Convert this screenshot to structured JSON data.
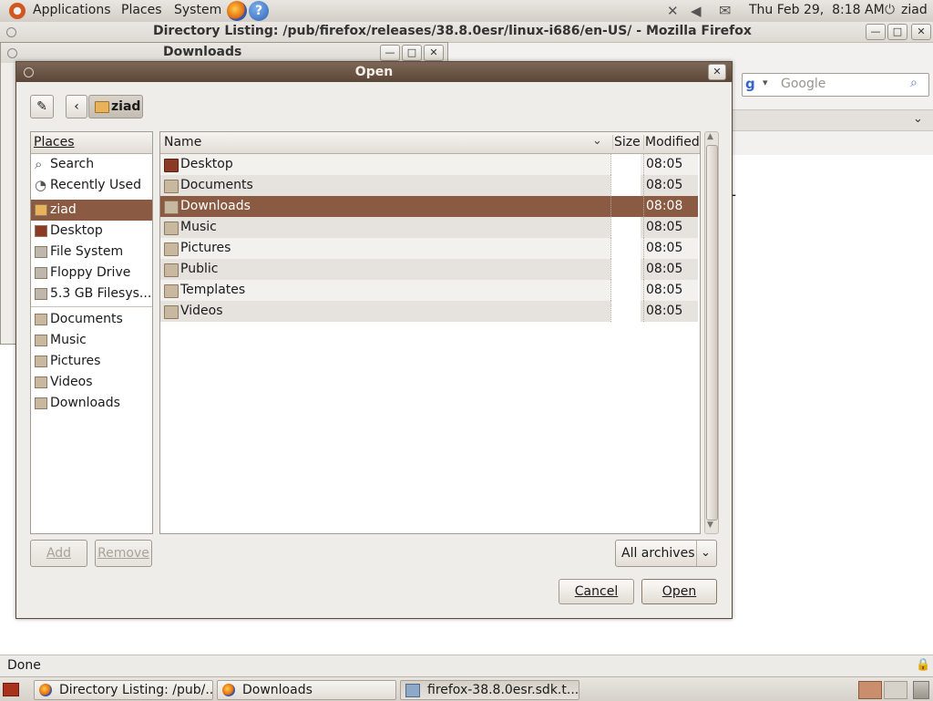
{
  "top_panel": {
    "menus": [
      "Applications",
      "Places",
      "System"
    ],
    "clock": "Thu Feb 29,  8:18 AM",
    "user": "ziad"
  },
  "firefox": {
    "title": "Directory Listing: /pub/firefox/releases/38.8.0esr/linux-i686/en-US/ - Mozilla Firefox",
    "search_placeholder": "Google",
    "status": "Done"
  },
  "downloads_window": {
    "title": "Downloads"
  },
  "dialog": {
    "title": "Open",
    "breadcrumb_current": "ziad",
    "places_header": "Places",
    "places": [
      {
        "label": "Search",
        "icon": "search-icon"
      },
      {
        "label": "Recently Used",
        "icon": "clock-icon"
      },
      {
        "label": "ziad",
        "icon": "home-folder-icon",
        "selected": true
      },
      {
        "label": "Desktop",
        "icon": "desktop-icon"
      },
      {
        "label": "File System",
        "icon": "drive-icon"
      },
      {
        "label": "Floppy Drive",
        "icon": "floppy-icon"
      },
      {
        "label": "5.3 GB Filesys...",
        "icon": "drive-icon"
      }
    ],
    "bookmarks": [
      {
        "label": "Documents",
        "icon": "documents-folder-icon"
      },
      {
        "label": "Music",
        "icon": "music-folder-icon"
      },
      {
        "label": "Pictures",
        "icon": "pictures-folder-icon"
      },
      {
        "label": "Videos",
        "icon": "videos-folder-icon"
      },
      {
        "label": "Downloads",
        "icon": "downloads-folder-icon"
      }
    ],
    "columns": {
      "name": "Name",
      "size": "Size",
      "modified": "Modified"
    },
    "files": [
      {
        "name": "Desktop",
        "size": "",
        "modified": "08:05"
      },
      {
        "name": "Documents",
        "size": "",
        "modified": "08:05"
      },
      {
        "name": "Downloads",
        "size": "",
        "modified": "08:08",
        "selected": true
      },
      {
        "name": "Music",
        "size": "",
        "modified": "08:05"
      },
      {
        "name": "Pictures",
        "size": "",
        "modified": "08:05"
      },
      {
        "name": "Public",
        "size": "",
        "modified": "08:05"
      },
      {
        "name": "Templates",
        "size": "",
        "modified": "08:05"
      },
      {
        "name": "Videos",
        "size": "",
        "modified": "08:05"
      }
    ],
    "add_label": "Add",
    "remove_label": "Remove",
    "filter": "All archives",
    "cancel_label": "Cancel",
    "open_label": "Open"
  },
  "taskbar": {
    "tasks": [
      {
        "label": "Directory Listing: /pub/..."
      },
      {
        "label": "Downloads"
      },
      {
        "label": "firefox-38.8.0esr.sdk.t...",
        "active": true
      }
    ]
  },
  "colors": {
    "selection": "#8b5a43",
    "panel": "#ddd9d2",
    "dialog_title": "#6b5546"
  }
}
